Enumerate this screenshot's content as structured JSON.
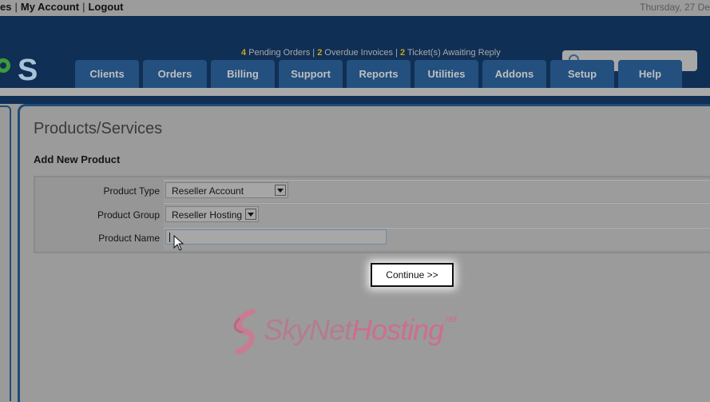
{
  "topbar": {
    "links": [
      "es",
      "My Account",
      "Logout"
    ],
    "date": "Thursday, 27 De"
  },
  "header": {
    "logo_text": "S",
    "notices": {
      "pending_count": "4",
      "pending_label": "Pending Orders",
      "overdue_count": "2",
      "overdue_label": "Overdue Invoices",
      "tickets_count": "2",
      "tickets_label": "Ticket(s) Awaiting Reply",
      "separator": "|"
    },
    "search": {
      "placeholder": "",
      "value": "",
      "icon": "search-icon"
    }
  },
  "nav": {
    "tabs": [
      {
        "label": "Clients"
      },
      {
        "label": "Orders"
      },
      {
        "label": "Billing"
      },
      {
        "label": "Support"
      },
      {
        "label": "Reports"
      },
      {
        "label": "Utilities"
      },
      {
        "label": "Addons"
      },
      {
        "label": "Setup"
      },
      {
        "label": "Help"
      }
    ]
  },
  "main": {
    "page_title": "Products/Services",
    "section_title": "Add New Product",
    "form": {
      "product_type_label": "Product Type",
      "product_type_value": "Reseller Account",
      "product_group_label": "Product Group",
      "product_group_value": "Reseller Hosting",
      "product_name_label": "Product Name",
      "product_name_value": ""
    },
    "continue_label": "Continue >>"
  },
  "watermark": {
    "part1": "SkyNet",
    "part2": "Hosting",
    "suffix": ".net"
  },
  "colors": {
    "header_bg": "#102f55",
    "nav_tab_bg": "#23507e",
    "notice_count": "#c7a51a",
    "overlay_bg": "#9a9a9a"
  }
}
